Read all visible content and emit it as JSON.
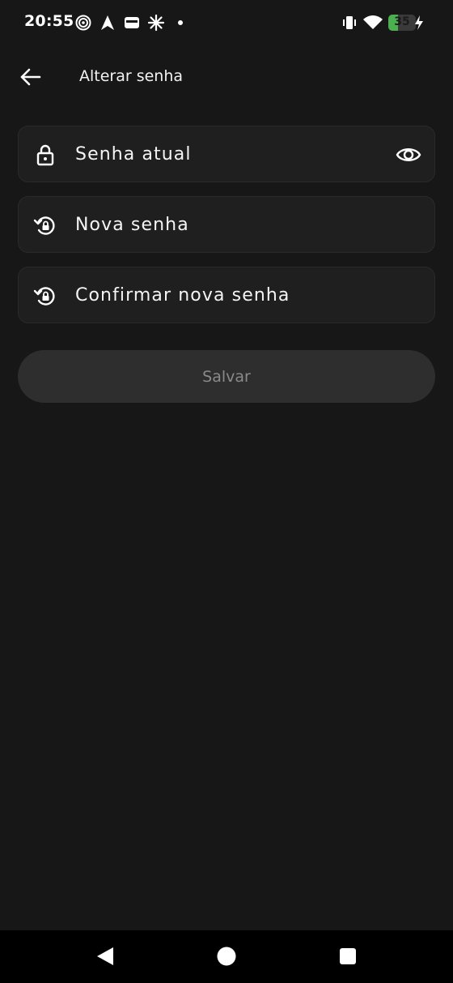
{
  "status_bar": {
    "time": "20:55",
    "battery_percent": 35,
    "battery_label": "35",
    "icons": [
      "spiral-icon",
      "navigation-arrow-icon",
      "wallet-icon",
      "sparkle-icon",
      "dot-icon",
      "vibrate-icon",
      "wifi-icon",
      "battery-charging-icon"
    ]
  },
  "app_bar": {
    "title": "Alterar senha",
    "back_icon": "arrow-left-icon"
  },
  "form": {
    "current_password": {
      "placeholder": "Senha atual",
      "icon": "lock-icon",
      "toggle_icon": "eye-icon"
    },
    "new_password": {
      "placeholder": "Nova senha",
      "icon": "lock-reset-icon"
    },
    "confirm_password": {
      "placeholder": "Confirmar nova senha",
      "icon": "lock-reset-icon"
    },
    "save_label": "Salvar"
  },
  "nav_bar": {
    "back": "triangle-back-icon",
    "home": "circle-home-icon",
    "recents": "square-recents-icon"
  },
  "colors": {
    "background": "#171717",
    "field_background": "#1f1f1f",
    "button_disabled": "#2e2e2e",
    "button_text_disabled": "#8a8a8a",
    "battery": "#4caf50"
  }
}
